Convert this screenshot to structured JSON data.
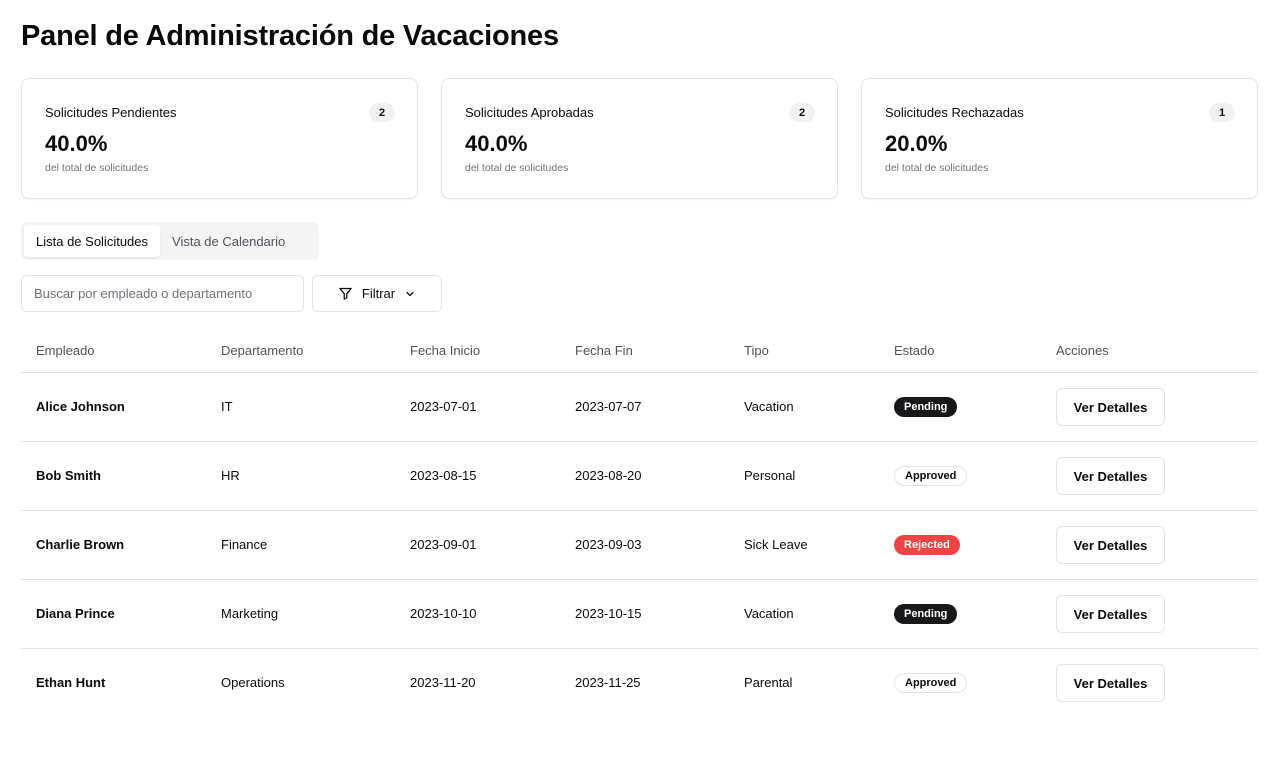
{
  "page": {
    "title": "Panel de Administración de Vacaciones"
  },
  "stats": [
    {
      "label": "Solicitudes Pendientes",
      "count": "2",
      "percent": "40.0%",
      "sub": "del total de solicitudes"
    },
    {
      "label": "Solicitudes Aprobadas",
      "count": "2",
      "percent": "40.0%",
      "sub": "del total de solicitudes"
    },
    {
      "label": "Solicitudes Rechazadas",
      "count": "1",
      "percent": "20.0%",
      "sub": "del total de solicitudes"
    }
  ],
  "tabs": [
    {
      "label": "Lista de Solicitudes",
      "active": true
    },
    {
      "label": "Vista de Calendario",
      "active": false
    }
  ],
  "search": {
    "placeholder": "Buscar por empleado o departamento",
    "value": ""
  },
  "filter": {
    "label": "Filtrar",
    "icon": "filter-icon",
    "chevron": "chevron-down-icon"
  },
  "table": {
    "headers": [
      "Empleado",
      "Departamento",
      "Fecha Inicio",
      "Fecha Fin",
      "Tipo",
      "Estado",
      "Acciones"
    ],
    "action_label": "Ver Detalles",
    "rows": [
      {
        "employee": "Alice Johnson",
        "department": "IT",
        "start": "2023-07-01",
        "end": "2023-07-07",
        "type": "Vacation",
        "status": "Pending",
        "status_kind": "pending"
      },
      {
        "employee": "Bob Smith",
        "department": "HR",
        "start": "2023-08-15",
        "end": "2023-08-20",
        "type": "Personal",
        "status": "Approved",
        "status_kind": "approved"
      },
      {
        "employee": "Charlie Brown",
        "department": "Finance",
        "start": "2023-09-01",
        "end": "2023-09-03",
        "type": "Sick Leave",
        "status": "Rejected",
        "status_kind": "rejected"
      },
      {
        "employee": "Diana Prince",
        "department": "Marketing",
        "start": "2023-10-10",
        "end": "2023-10-15",
        "type": "Vacation",
        "status": "Pending",
        "status_kind": "pending"
      },
      {
        "employee": "Ethan Hunt",
        "department": "Operations",
        "start": "2023-11-20",
        "end": "2023-11-25",
        "type": "Parental",
        "status": "Approved",
        "status_kind": "approved"
      }
    ]
  },
  "colors": {
    "pending": "#18181b",
    "rejected": "#ef4444",
    "border": "#e4e4e7",
    "muted": "#71717a"
  }
}
